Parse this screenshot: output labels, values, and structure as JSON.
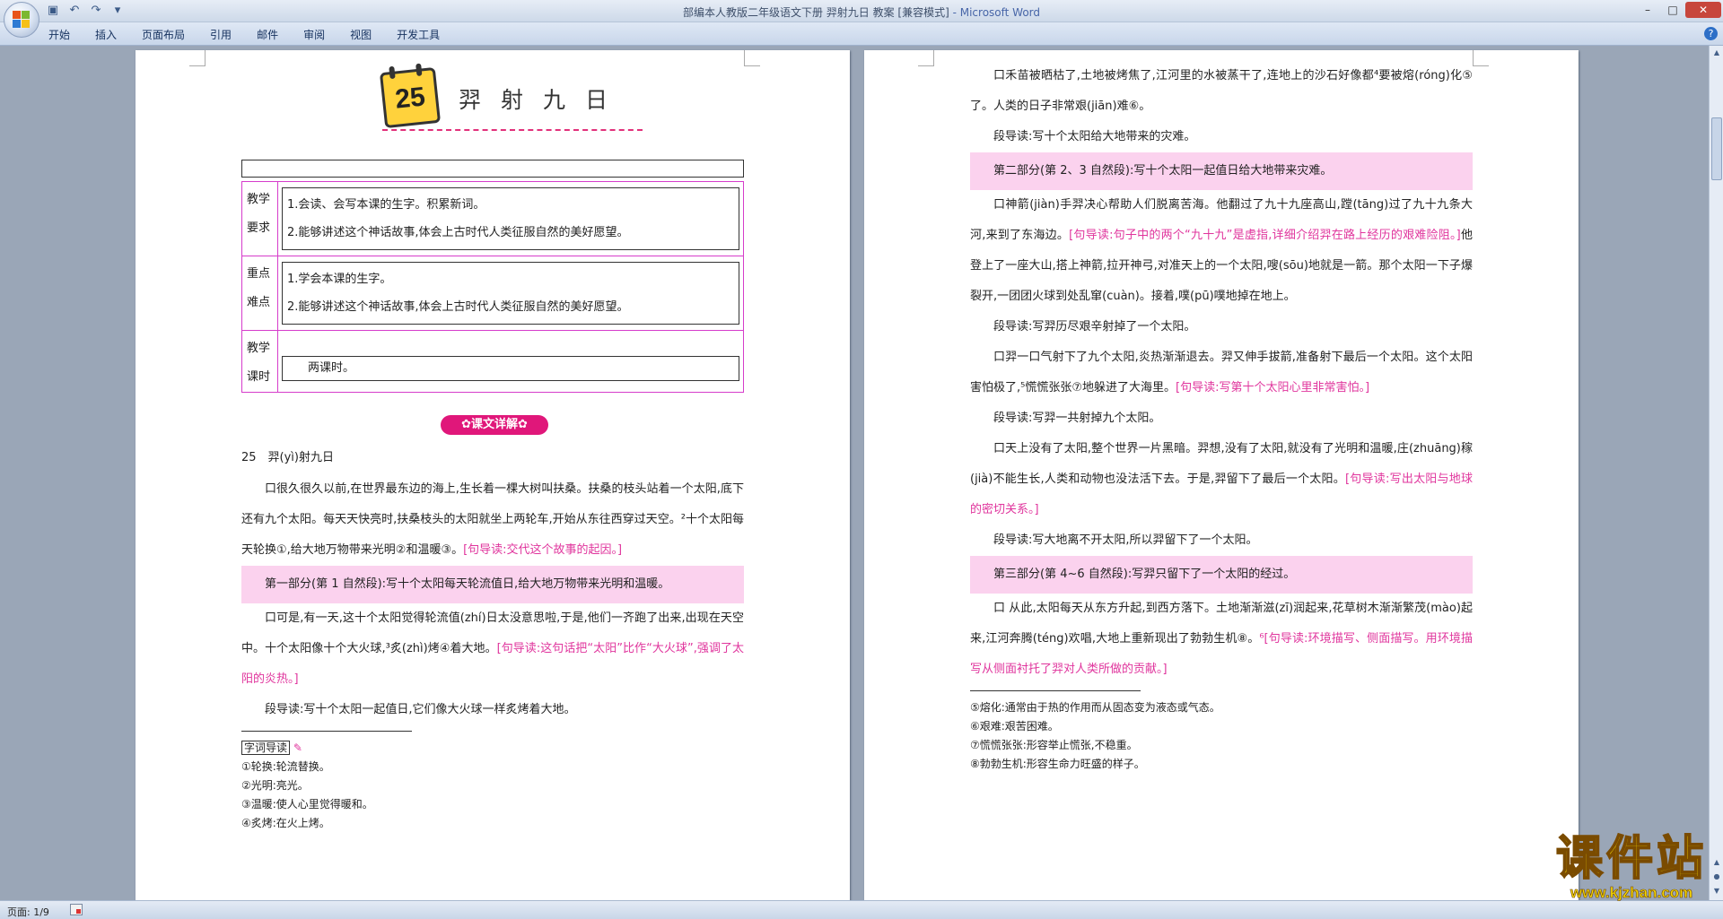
{
  "window": {
    "title": "部编本人教版二年级语文下册 羿射九日 教案 [兼容模式]",
    "app_suffix": " - Microsoft Word"
  },
  "ribbon_tabs": [
    "开始",
    "插入",
    "页面布局",
    "引用",
    "邮件",
    "审阅",
    "视图",
    "开发工具"
  ],
  "page1": {
    "lesson_number": "25",
    "lesson_title": "羿射九日",
    "table": {
      "rows": [
        {
          "label": "教学要求",
          "items": [
            "1.会读、会写本课的生字。积累新词。",
            "2.能够讲述这个神话故事,体会上古时代人类征服自然的美好愿望。"
          ]
        },
        {
          "label": "重点难点",
          "items": [
            "1.学会本课的生字。",
            "2.能够讲述这个神话故事,体会上古时代人类征服自然的美好愿望。"
          ]
        },
        {
          "label": "教学课时",
          "items": [
            "两课时。"
          ]
        }
      ]
    },
    "section_badge": "✿课文详解✿",
    "heading": "25　羿(yì)射九日",
    "paragraphs": [
      {
        "text": "口很久很久以前,在世界最东边的海上,生长着一棵大树叫扶桑。扶桑的枝头站着一个太阳,底下还有九个太阳。每天天快亮时,扶桑枝头的太阳就坐上两轮车,开始从东往西穿过天空。²十个太阳每天轮换①,给大地万物带来光明②和温暖③。",
        "note": "[句导读:交代这个故事的起因。]"
      },
      {
        "text": "第一部分(第 1 自然段):写十个太阳每天轮流值日,给大地万物带来光明和温暖。",
        "highlight": true
      },
      {
        "text": "口可是,有一天,这十个太阳觉得轮流值(zhí)日太没意思啦,于是,他们一齐跑了出来,出现在天空中。十个太阳像十个大火球,³炙(zhì)烤④着大地。",
        "note": "[句导读:这句话把“太阳”比作“大火球”,强调了太阳的炎热。]"
      },
      {
        "text": "段导读:写十个太阳一起值日,它们像大火球一样炙烤着大地。"
      }
    ],
    "footnote_heading": "字词导读",
    "footnotes": [
      "①轮换:轮流替换。",
      "②光明:亮光。",
      "③温暖:使人心里觉得暖和。",
      "④炙烤:在火上烤。"
    ]
  },
  "page2": {
    "paragraphs": [
      {
        "text": "口禾苗被晒枯了,土地被烤焦了,江河里的水被蒸干了,连地上的沙石好像都⁴要被熔(róng)化⑤了。人类的日子非常艰(jiān)难⑥。"
      },
      {
        "text": "段导读:写十个太阳给大地带来的灾难。"
      },
      {
        "text": "第二部分(第 2、3 自然段):写十个太阳一起值日给大地带来灾难。",
        "highlight": true
      },
      {
        "text": "口神箭(jiàn)手羿决心帮助人们脱离苦海。他翻过了九十九座高山,蹚(tāng)过了九十九条大河,来到了东海边。",
        "note": "[句导读:句子中的两个“九十九”是虚指,详细介绍羿在路上经历的艰难险阻。]",
        "tail": "他登上了一座大山,搭上神箭,拉开神弓,对准天上的一个太阳,嗖(sōu)地就是一箭。那个太阳一下子爆裂开,一团团火球到处乱窜(cuàn)。接着,噗(pū)噗地掉在地上。"
      },
      {
        "text": "段导读:写羿历尽艰辛射掉了一个太阳。"
      },
      {
        "text": "口羿一口气射下了九个太阳,炎热渐渐退去。羿又伸手拔箭,准备射下最后一个太阳。这个太阳害怕极了,⁵慌慌张张⑦地躲进了大海里。",
        "note": "[句导读:写第十个太阳心里非常害怕。]"
      },
      {
        "text": "段导读:写羿一共射掉九个太阳。"
      },
      {
        "text": "口天上没有了太阳,整个世界一片黑暗。羿想,没有了太阳,就没有了光明和温暖,庄(zhuāng)稼(jià)不能生长,人类和动物也没法活下去。于是,羿留下了最后一个太阳。",
        "note": "[句导读:写出太阳与地球的密切关系。]"
      },
      {
        "text": "段导读:写大地离不开太阳,所以羿留下了一个太阳。"
      },
      {
        "text": "第三部分(第 4~6 自然段):写羿只留下了一个太阳的经过。",
        "highlight": true
      },
      {
        "text": "口 从此,太阳每天从东方升起,到西方落下。土地渐渐滋(zī)润起来,花草树木渐渐繁茂(mào)起来,江河奔腾(téng)欢唱,大地上重新现出了勃勃生机⑧。",
        "note": "⁶[句导读:环境描写、侧面描写。用环境描写从侧面衬托了羿对人类所做的贡献。]"
      }
    ],
    "footnotes": [
      "⑤熔化:通常由于热的作用而从固态变为液态或气态。",
      "⑥艰难:艰苦困难。",
      "⑦慌慌张张:形容举止慌张,不稳重。",
      "⑧勃勃生机:形容生命力旺盛的样子。"
    ]
  },
  "status": {
    "page": "页面: 1/9"
  },
  "watermark": {
    "title": "课件站",
    "url": "www.kjzhan.com"
  },
  "colors": {
    "accent": "#e0359d",
    "highlight": "#fbd2ee",
    "table_border": "#d63ccb",
    "watermark": "#f5d800"
  },
  "icons": [
    "office-button-icon",
    "save-icon",
    "undo-icon",
    "redo-icon",
    "help-icon",
    "calendar-icon"
  ]
}
